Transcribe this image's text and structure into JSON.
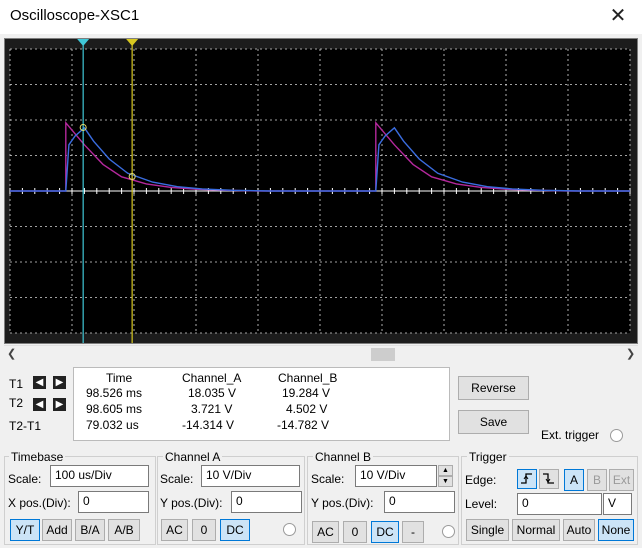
{
  "window": {
    "title": "Oscilloscope-XSC1",
    "close_glyph": "✕"
  },
  "cursors": {
    "t1_label": "T1",
    "t2_label": "T2",
    "diff_label": "T2-T1"
  },
  "readout": {
    "headers": {
      "time": "Time",
      "channel_a": "Channel_A",
      "channel_b": "Channel_B"
    },
    "t1": {
      "time": "98.526 ms",
      "a": "18.035 V",
      "b": "19.284 V"
    },
    "t2": {
      "time": "98.605 ms",
      "a": "3.721 V",
      "b": "4.502 V"
    },
    "diff": {
      "time": "79.032 us",
      "a": "-14.314 V",
      "b": "-14.782 V"
    }
  },
  "buttons": {
    "reverse": "Reverse",
    "save": "Save",
    "ext_trigger": "Ext. trigger"
  },
  "timebase": {
    "title": "Timebase",
    "scale_label": "Scale:",
    "scale_value": "100 us/Div",
    "xpos_label": "X pos.(Div):",
    "xpos_value": "0",
    "modes": [
      "Y/T",
      "Add",
      "B/A",
      "A/B"
    ],
    "selected_mode": "Y/T"
  },
  "channel_a": {
    "title": "Channel A",
    "scale_label": "Scale:",
    "scale_value": "10  V/Div",
    "ypos_label": "Y pos.(Div):",
    "ypos_value": "0",
    "coupling": [
      "AC",
      "0",
      "DC"
    ],
    "selected": "DC"
  },
  "channel_b": {
    "title": "Channel B",
    "scale_label": "Scale:",
    "scale_value": "10  V/Div",
    "ypos_label": "Y pos.(Div):",
    "ypos_value": "0",
    "coupling": [
      "AC",
      "0",
      "DC",
      "-"
    ],
    "selected": "DC"
  },
  "trigger": {
    "title": "Trigger",
    "edge_label": "Edge:",
    "level_label": "Level:",
    "level_value": "0",
    "level_unit": "V",
    "sources": [
      "A",
      "B",
      "Ext"
    ],
    "selected_source": "A",
    "modes": [
      "Single",
      "Normal",
      "Auto",
      "None"
    ],
    "selected_mode": "None"
  },
  "colors": {
    "screen_bg": "#000000",
    "grid": "#d8d8d8",
    "channel_a": "#b4289c",
    "channel_b": "#3a6de0",
    "cursor_t1": "#40c8d8",
    "cursor_t2": "#d8c820",
    "button_selected": "#cce4f7"
  },
  "chart_data": {
    "type": "line",
    "title": "",
    "xlabel": "",
    "ylabel": "",
    "x_divisions": 10,
    "y_divisions": 8,
    "x_scale_per_div": "100 us/Div",
    "y_scale_per_div": "10 V/Div",
    "series": [
      {
        "name": "Channel_A",
        "color": "#b4289c",
        "points": [
          [
            0,
            0
          ],
          [
            0.9,
            0
          ],
          [
            0.9,
            19.2
          ],
          [
            1.2,
            13
          ],
          [
            1.5,
            7.5
          ],
          [
            1.8,
            4
          ],
          [
            2.2,
            2
          ],
          [
            2.6,
            1
          ],
          [
            3,
            0.5
          ],
          [
            3.5,
            0.2
          ],
          [
            4,
            0
          ],
          [
            5,
            0
          ],
          [
            5.9,
            0
          ],
          [
            5.9,
            19.2
          ],
          [
            6.2,
            13
          ],
          [
            6.5,
            7.5
          ],
          [
            6.8,
            4
          ],
          [
            7.2,
            2
          ],
          [
            7.6,
            1
          ],
          [
            8,
            0.5
          ],
          [
            8.5,
            0.2
          ],
          [
            9,
            0
          ],
          [
            10,
            0
          ]
        ]
      },
      {
        "name": "Channel_B",
        "color": "#3a6de0",
        "points": [
          [
            0,
            0
          ],
          [
            0.9,
            0
          ],
          [
            0.95,
            13
          ],
          [
            1.05,
            15.5
          ],
          [
            1.2,
            17.8
          ],
          [
            1.35,
            14
          ],
          [
            1.6,
            9
          ],
          [
            1.9,
            5
          ],
          [
            2.3,
            2.5
          ],
          [
            2.7,
            1.2
          ],
          [
            3.1,
            0.6
          ],
          [
            3.6,
            0.2
          ],
          [
            4.2,
            0
          ],
          [
            5,
            0
          ],
          [
            5.9,
            0
          ],
          [
            5.95,
            13
          ],
          [
            6.05,
            15.5
          ],
          [
            6.2,
            17.8
          ],
          [
            6.35,
            14
          ],
          [
            6.6,
            9
          ],
          [
            6.9,
            5
          ],
          [
            7.3,
            2.5
          ],
          [
            7.7,
            1.2
          ],
          [
            8.1,
            0.6
          ],
          [
            8.6,
            0.2
          ],
          [
            9.2,
            0
          ],
          [
            10,
            0
          ]
        ]
      }
    ],
    "cursor_t1_time": "98.526 ms",
    "cursor_t2_time": "98.605 ms"
  }
}
